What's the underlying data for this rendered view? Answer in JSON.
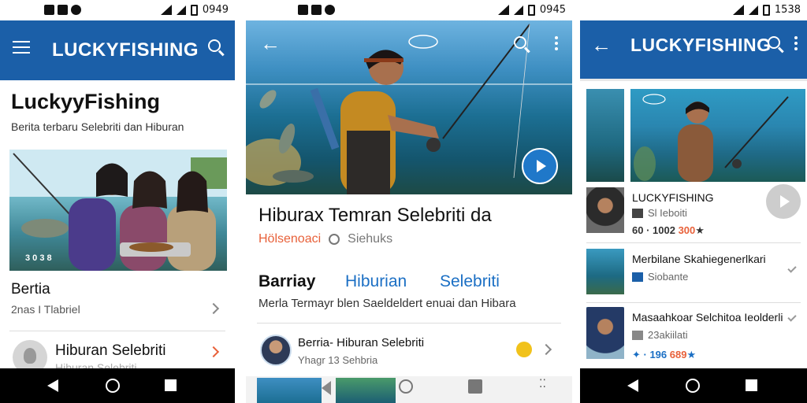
{
  "phone1": {
    "status_time": "0949",
    "app_title": "LUCKYFISHING",
    "page_title": "LuckyyFishing",
    "subtitle": "Berita terbaru Selebriti dan Hiburan",
    "photo_caption": "3 0 3 8",
    "row1": {
      "title": "Bertia",
      "sub": "2nas I Tlabriel"
    },
    "row2": {
      "title": "Hiburan Selebriti",
      "sub": "Hiburan Selebriti"
    }
  },
  "phone2": {
    "status_time": "0945",
    "headline": "Hiburax Temran Selebriti da",
    "meta_source": "Hölsenoaci",
    "meta_search_label": "Siehuks",
    "tabs": [
      {
        "label": "Barriay"
      },
      {
        "label": "Hiburian"
      },
      {
        "label": "Selebriti"
      }
    ],
    "description": "Merla Termayr blen Saeldeldert enuai dan Hibara",
    "list_item": {
      "title": "Berria- Hiburan Selebriti",
      "sub": "Yhagr 13 Sehbria"
    }
  },
  "phone3": {
    "status_time": "1538",
    "app_title": "LUCKYFISHING",
    "items": [
      {
        "title": "LUCKYFISHING",
        "sub": "Sl Ieboiti",
        "stats_prefix": "60 · 1002",
        "stats_highlight": "300",
        "stats_suffix": "★"
      },
      {
        "title": "Merbilane Skahiegenerlkari",
        "sub": "Siobante"
      },
      {
        "title": "Masaahkoar Selchitoa Ieolderli",
        "sub": "23akiilati",
        "stats_prefix": "✦ · 196",
        "stats_highlight": "689",
        "stats_suffix": "★"
      }
    ]
  },
  "colors": {
    "appbar": "#1b5fa8",
    "accent": "#e8613a",
    "link": "#1b6fc4",
    "play": "#1f78c9"
  },
  "icons": [
    "menu-icon",
    "search-icon",
    "back-arrow-icon",
    "more-vert-icon",
    "play-icon",
    "chevron-right-icon",
    "checkmark-icon",
    "nav-back-icon",
    "nav-home-icon",
    "nav-recents-icon"
  ]
}
